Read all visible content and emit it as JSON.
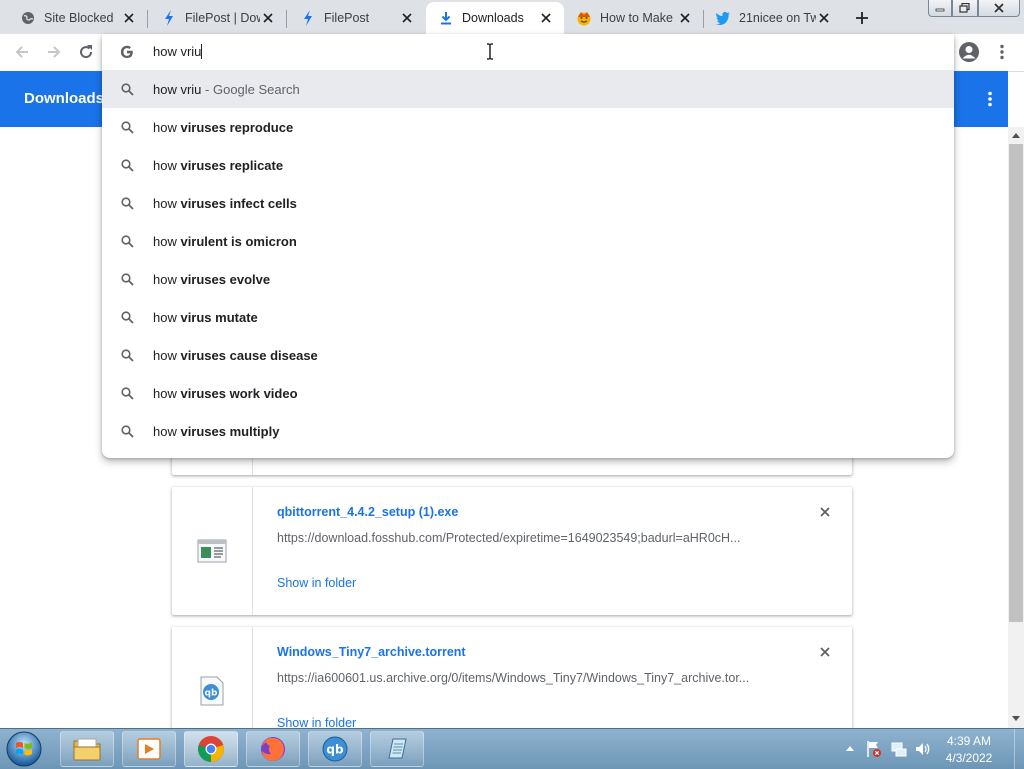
{
  "tabs": [
    {
      "title": "Site Blocked",
      "icon": "globe-icon"
    },
    {
      "title": "FilePost | Dow",
      "icon": "bolt-icon"
    },
    {
      "title": "FilePost",
      "icon": "bolt-icon"
    },
    {
      "title": "Downloads",
      "icon": "download-icon"
    },
    {
      "title": "How to Make",
      "icon": "emoji-icon"
    },
    {
      "title": "21nicee on Tw",
      "icon": "twitter-icon"
    }
  ],
  "omnibox": {
    "text": "how vriu",
    "suggestions": [
      {
        "prefix": "how vriu",
        "bold": "",
        "suffix": " - Google Search"
      },
      {
        "prefix": "how ",
        "bold": "viruses reproduce",
        "suffix": ""
      },
      {
        "prefix": "how ",
        "bold": "viruses replicate",
        "suffix": ""
      },
      {
        "prefix": "how ",
        "bold": "viruses infect cells",
        "suffix": ""
      },
      {
        "prefix": "how ",
        "bold": "virulent is omicron",
        "suffix": ""
      },
      {
        "prefix": "how ",
        "bold": "viruses evolve",
        "suffix": ""
      },
      {
        "prefix": "how ",
        "bold": "virus mutate",
        "suffix": ""
      },
      {
        "prefix": "how ",
        "bold": "viruses cause disease",
        "suffix": ""
      },
      {
        "prefix": "how ",
        "bold": "viruses work video",
        "suffix": ""
      },
      {
        "prefix": "how ",
        "bold": "viruses multiply",
        "suffix": ""
      }
    ]
  },
  "page": {
    "title": "Downloads"
  },
  "downloads": [
    {
      "filename": "qbittorrent_4.4.2_setup (1).exe",
      "url": "https://download.fosshub.com/Protected/expiretime=1649023549;badurl=aHR0cH...",
      "action": "Show in folder",
      "icon": "installer-file-icon"
    },
    {
      "filename": "Windows_Tiny7_archive.torrent",
      "url": "https://ia600601.us.archive.org/0/items/Windows_Tiny7/Windows_Tiny7_archive.tor...",
      "action": "Show in folder",
      "icon": "qbittorrent-file-icon"
    }
  ],
  "taskbar": {
    "apps": [
      "explorer-icon",
      "media-player-icon",
      "chrome-icon",
      "firefox-icon",
      "qbittorrent-icon",
      "notepad-icon"
    ],
    "time": "4:39 AM",
    "date": "4/3/2022"
  },
  "colors": {
    "accent": "#1a73e8",
    "tabstrip": "#dee1e6",
    "highlight": "#e8eaed"
  }
}
